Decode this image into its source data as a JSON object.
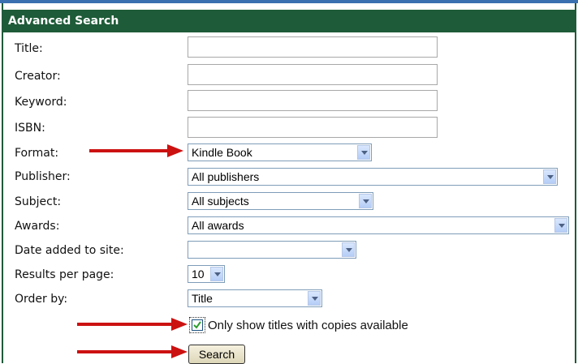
{
  "form": {
    "header": "Advanced Search",
    "fields": {
      "title": {
        "label": "Title:",
        "value": ""
      },
      "creator": {
        "label": "Creator:",
        "value": ""
      },
      "keyword": {
        "label": "Keyword:",
        "value": ""
      },
      "isbn": {
        "label": "ISBN:",
        "value": ""
      },
      "format": {
        "label": "Format:",
        "selected": "Kindle Book"
      },
      "publisher": {
        "label": "Publisher:",
        "selected": "All publishers"
      },
      "subject": {
        "label": "Subject:",
        "selected": "All subjects"
      },
      "awards": {
        "label": "Awards:",
        "selected": "All awards"
      },
      "date_added": {
        "label": "Date added to site:",
        "selected": ""
      },
      "results_per_page": {
        "label": "Results per page:",
        "selected": "10"
      },
      "order_by": {
        "label": "Order by:",
        "selected": "Title"
      }
    },
    "only_available": {
      "label": "Only show titles with copies available",
      "checked": true
    },
    "search_button": "Search"
  },
  "annotations": {
    "arrow_color": "#cc1111",
    "arrow_targets": [
      "format-select",
      "only-available-checkbox",
      "search-button"
    ]
  },
  "colors": {
    "header_bg": "#1e5b38",
    "top_rule": "#3a6fb0"
  }
}
